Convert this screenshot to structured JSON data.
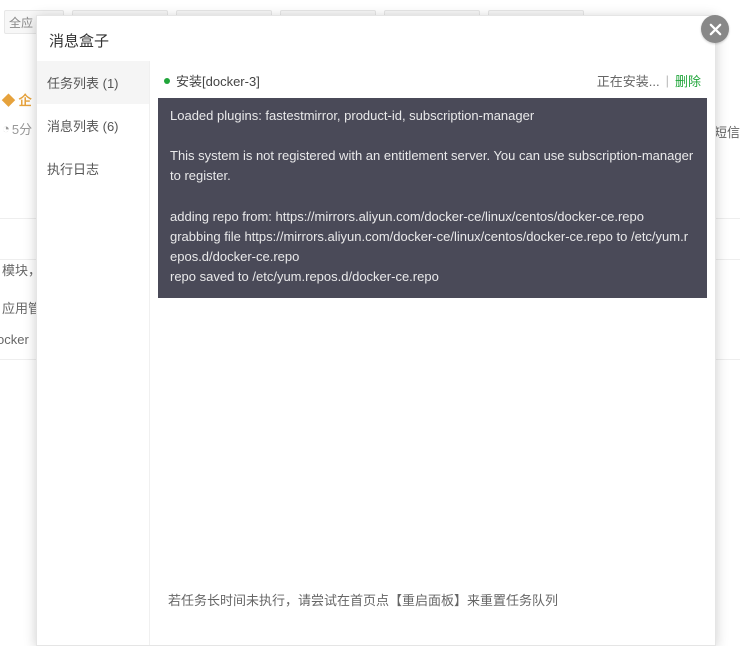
{
  "bg": {
    "toolbar_first": "全应",
    "warn_icon": "◆",
    "warn_text": "企",
    "clock_icon": "◔",
    "clock_text": "5分",
    "right_text": "赞短信",
    "row1": "模块，",
    "row2": "应用管",
    "row3": "ocker"
  },
  "modal": {
    "title": "消息盒子",
    "sidebar": [
      {
        "label": "任务列表 (1)",
        "active": true
      },
      {
        "label": "消息列表 (6)",
        "active": false
      },
      {
        "label": "执行日志",
        "active": false
      }
    ],
    "task": {
      "title": "安装[docker-3]",
      "status": "正在安装...",
      "delete": "删除"
    },
    "console": "Loaded plugins: fastestmirror, product-id, subscription-manager\n\nThis system is not registered with an entitlement server. You can use subscription-manager to register.\n\nadding repo from: https://mirrors.aliyun.com/docker-ce/linux/centos/docker-ce.repo\ngrabbing file https://mirrors.aliyun.com/docker-ce/linux/centos/docker-ce.repo to /etc/yum.repos.d/docker-ce.repo\nrepo saved to /etc/yum.repos.d/docker-ce.repo",
    "footer": "若任务长时间未执行，请尝试在首页点【重启面板】来重置任务队列"
  }
}
